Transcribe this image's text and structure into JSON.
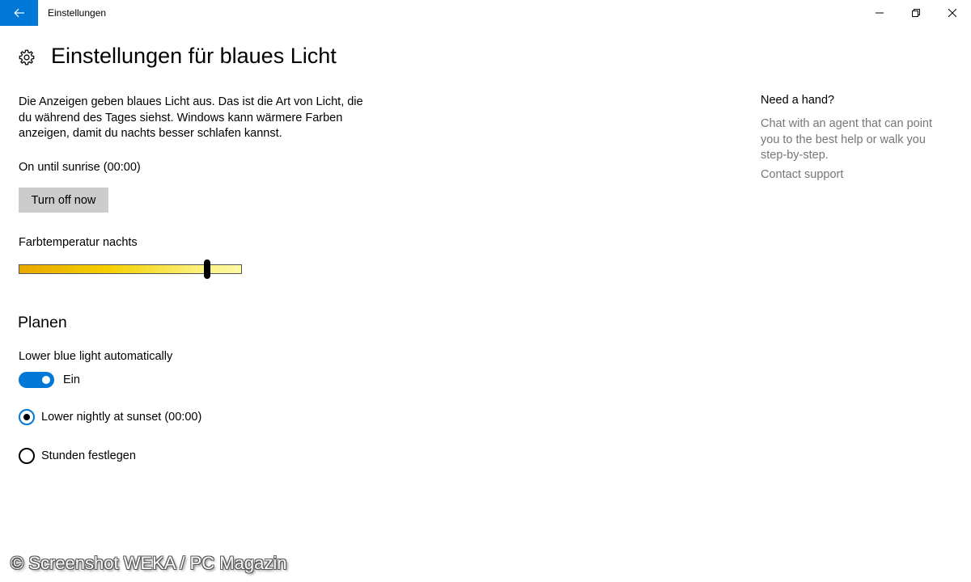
{
  "window": {
    "app_title": "Einstellungen",
    "accent_color": "#0078d7"
  },
  "header": {
    "title": "Einstellungen für blaues Licht",
    "icon": "gear-icon"
  },
  "main": {
    "description": "Die Anzeigen geben blaues Licht aus. Das ist die Art von Licht, die du während des Tages siehst. Windows kann wärmere Farben anzeigen, damit du nachts besser schlafen kannst.",
    "status": "On until sunrise (00:00)",
    "turn_off_label": "Turn off now",
    "slider": {
      "label": "Farbtemperatur nachts",
      "value_fraction": 0.85
    }
  },
  "schedule": {
    "heading": "Planen",
    "toggle_label": "Lower blue light automatically",
    "toggle_state": "Ein",
    "toggle_on": true,
    "options": [
      {
        "label": "Lower nightly at sunset (00:00)",
        "checked": true
      },
      {
        "label": "Stunden festlegen",
        "checked": false
      }
    ]
  },
  "help": {
    "title": "Need a hand?",
    "body": "Chat with an agent that can point you to the best help or walk you step-by-step.",
    "link": "Contact support"
  },
  "watermark": "© Screenshot WEKA / PC Magazin"
}
